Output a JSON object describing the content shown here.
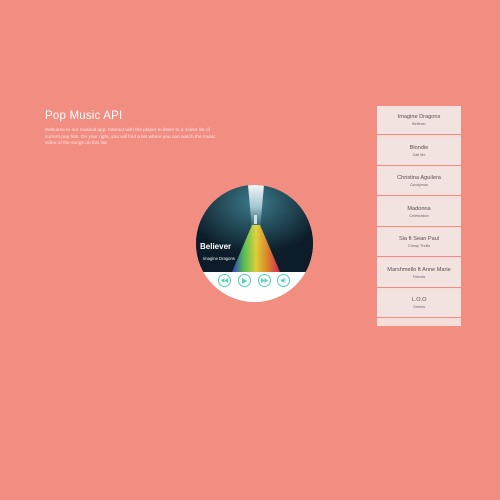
{
  "intro": {
    "title": "Pop Music API",
    "text": "Welcome to our musical app. Interact with the player to listen to a select list of current pop hits. On your right, you will find a list where you can watch the music video of the songs on this list."
  },
  "player": {
    "song_title": "Believer",
    "artist": "Imagine Dragons",
    "controls": [
      "previous-icon",
      "play-icon",
      "next-icon",
      "volume-icon"
    ],
    "accent_color": "#4fd1b6"
  },
  "playlist": [
    {
      "artist": "Imagine Dragons",
      "song": "Believer"
    },
    {
      "artist": "Blondie",
      "song": "Call Me"
    },
    {
      "artist": "Christina Aguilera",
      "song": "Candyman"
    },
    {
      "artist": "Madonna",
      "song": "Celebration"
    },
    {
      "artist": "Sia ft Sean Paul",
      "song": "Cheap Thrills"
    },
    {
      "artist": "Marshmello ft Anne Marie",
      "song": "Friends"
    },
    {
      "artist": "L.O.O",
      "song": "Genius"
    }
  ],
  "colors": {
    "background": "#f28d82",
    "playlist_item": "#f2e3e1",
    "accent": "#4fd1b6"
  }
}
